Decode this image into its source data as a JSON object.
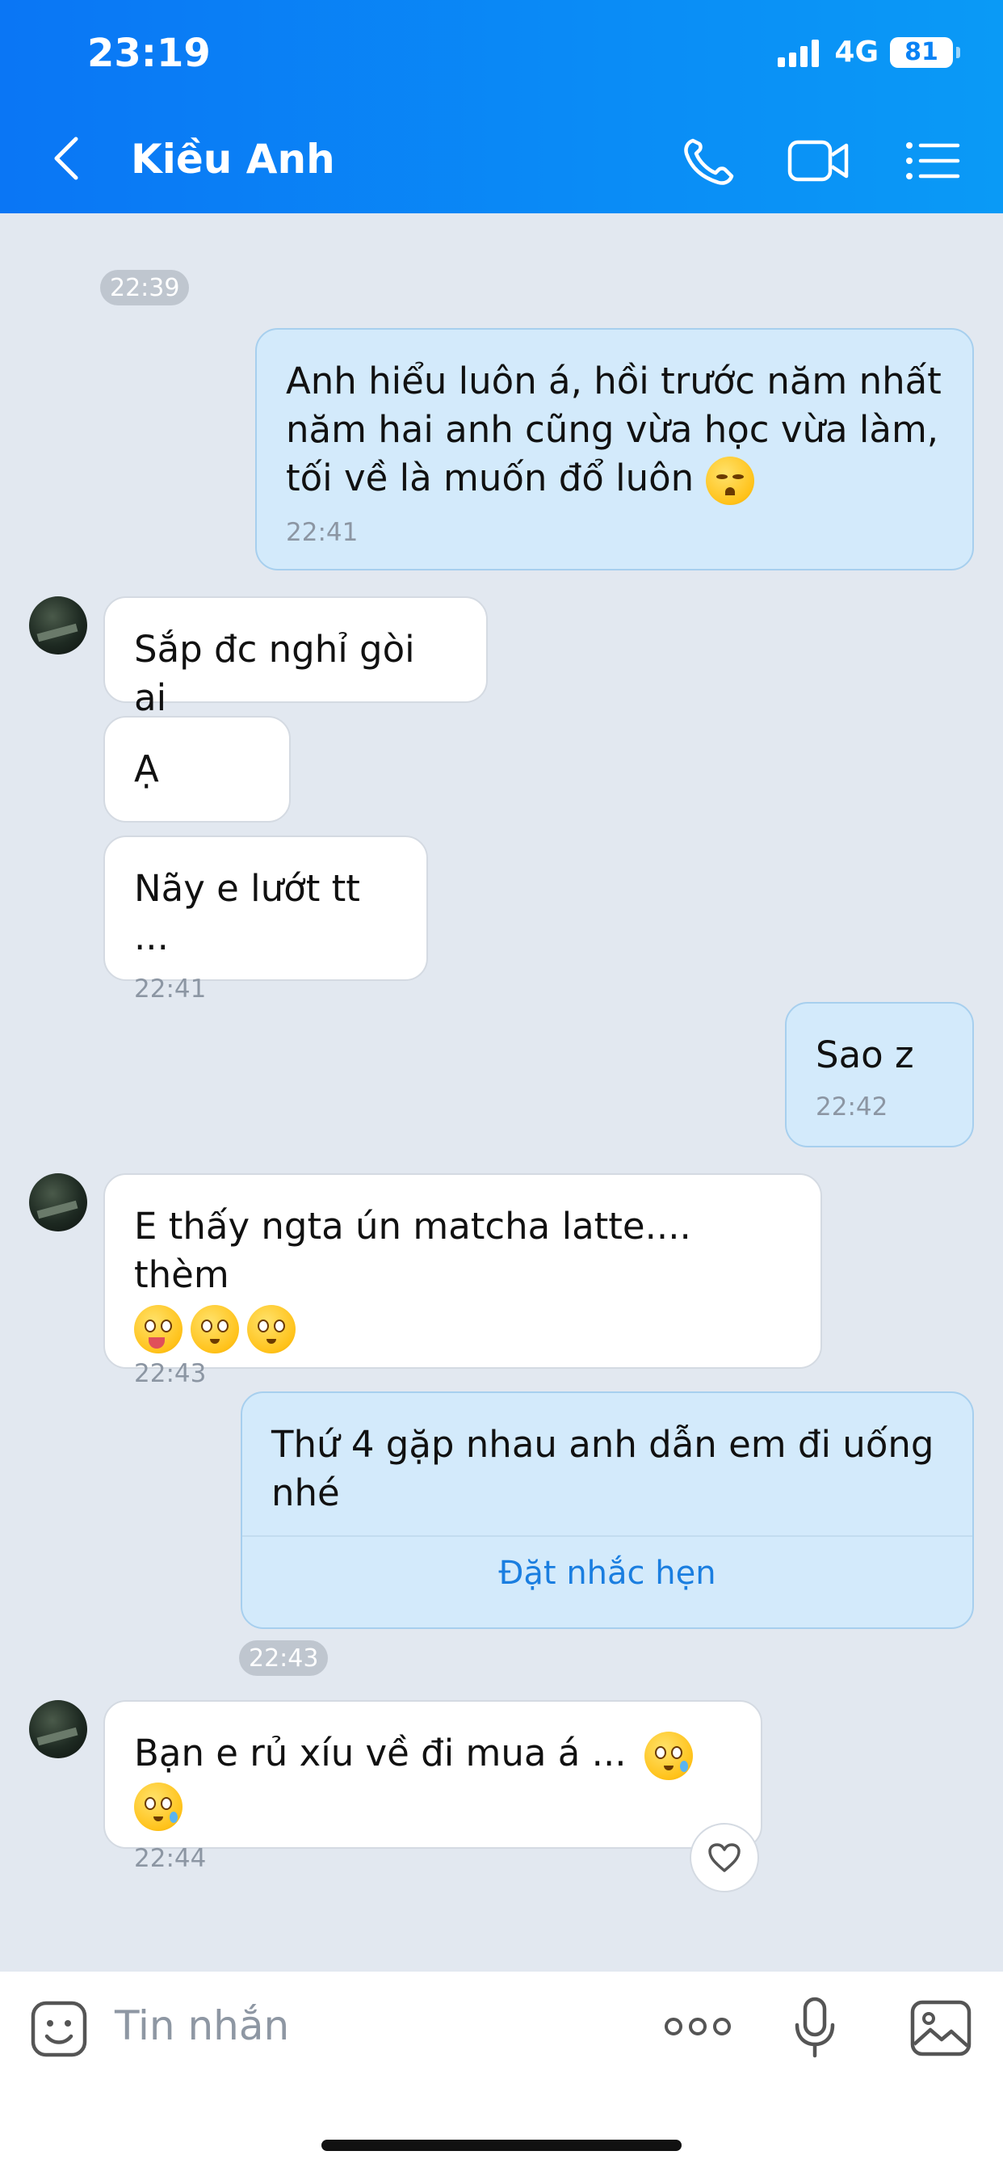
{
  "status": {
    "time": "23:19",
    "network": "4G",
    "battery": "81"
  },
  "header": {
    "title": "Kiều Anh"
  },
  "messages": [
    {
      "kind": "time",
      "text": "22:39"
    },
    {
      "kind": "out",
      "text": "Anh hiểu luôn á, hồi trước năm nhất năm hai anh cũng vừa học vừa làm, tối về là muốn đổ luôn",
      "time": "22:41",
      "emoji": "weary-face-emoji"
    },
    {
      "kind": "in",
      "text": "Sắp đc nghỉ gòi ai"
    },
    {
      "kind": "in",
      "text": "Ạ"
    },
    {
      "kind": "in",
      "text": "Nãy e lướt tt ...",
      "time": "22:41"
    },
    {
      "kind": "out",
      "text": "Sao z",
      "time": "22:42"
    },
    {
      "kind": "in",
      "text": "E thấy ngta ún matcha latte.... thèm",
      "time": "22:43",
      "emoji": "tongue-and-pleading-face-emojis"
    },
    {
      "kind": "out",
      "text": "Thứ 4 gặp nhau anh dẫn em đi uống nhé",
      "action": "Đặt nhắc hẹn"
    },
    {
      "kind": "time",
      "text": "22:43"
    },
    {
      "kind": "in",
      "text": "Bạn e rủ xíu về đi mua á ...",
      "time": "22:44",
      "emoji": "pleading-tear-face-emojis"
    }
  ],
  "input": {
    "placeholder": "Tin nhắn"
  },
  "colors": {
    "header_start": "#0a76f5",
    "header_end": "#0a9af6",
    "outgoing_bubble": "#d3eafb",
    "incoming_bubble": "#ffffff",
    "chat_background": "#e2e8f0",
    "link": "#1a7ee0"
  }
}
